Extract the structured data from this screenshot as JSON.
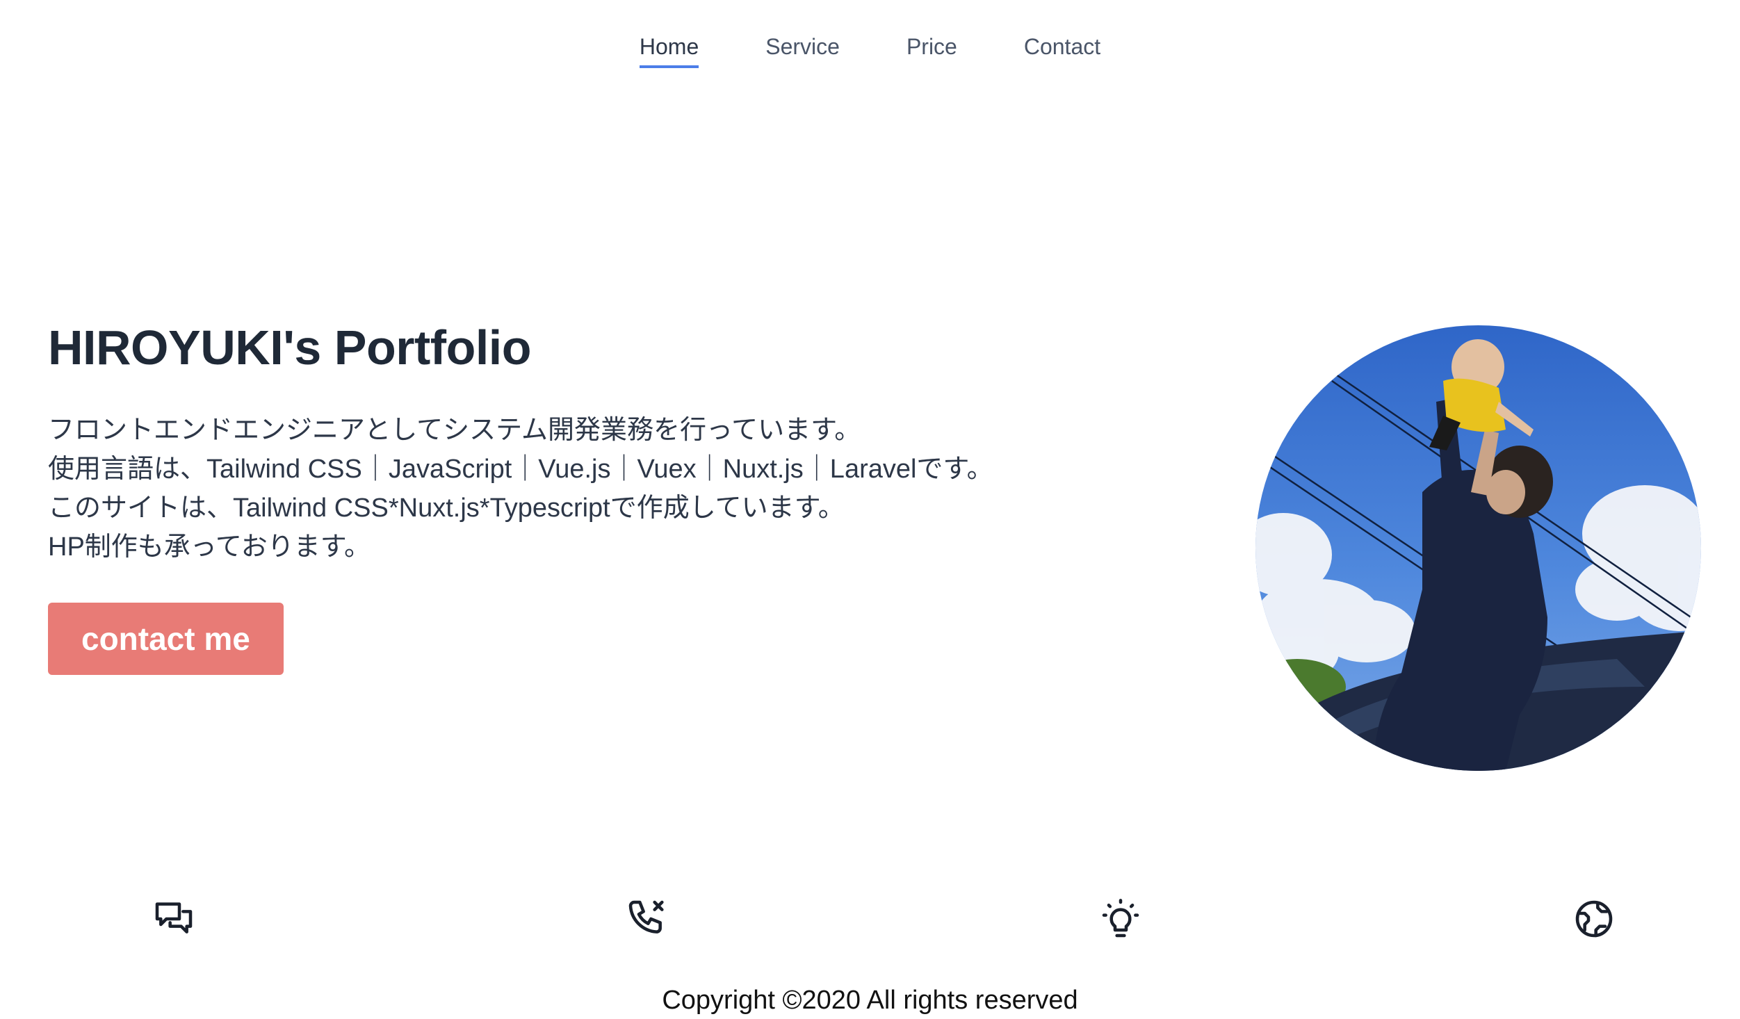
{
  "nav": {
    "items": [
      {
        "label": "Home",
        "active": true
      },
      {
        "label": "Service",
        "active": false
      },
      {
        "label": "Price",
        "active": false
      },
      {
        "label": "Contact",
        "active": false
      }
    ]
  },
  "hero": {
    "title": "HIROYUKI's Portfolio",
    "lines": [
      "フロントエンドエンジニアとしてシステム開発業務を行っています。",
      "使用言語は、Tailwind CSS｜JavaScript｜Vue.js｜Vuex｜Nuxt.js｜Laravelです。",
      "このサイトは、Tailwind CSS*Nuxt.js*Typescriptで作成しています。",
      "HP制作も承っております。"
    ],
    "button_label": "contact me",
    "photo": "circular-photo-person-lifting-baby-sky"
  },
  "icons": [
    {
      "name": "chat-bubbles-icon"
    },
    {
      "name": "phone-missed-icon"
    },
    {
      "name": "lightbulb-icon"
    },
    {
      "name": "globe-icon"
    }
  ],
  "colors": {
    "accent": "#4c7ee8",
    "button": "#e87b76",
    "title": "#1f2937"
  },
  "footer": {
    "copyright": "Copyright ©2020 All rights reserved"
  }
}
